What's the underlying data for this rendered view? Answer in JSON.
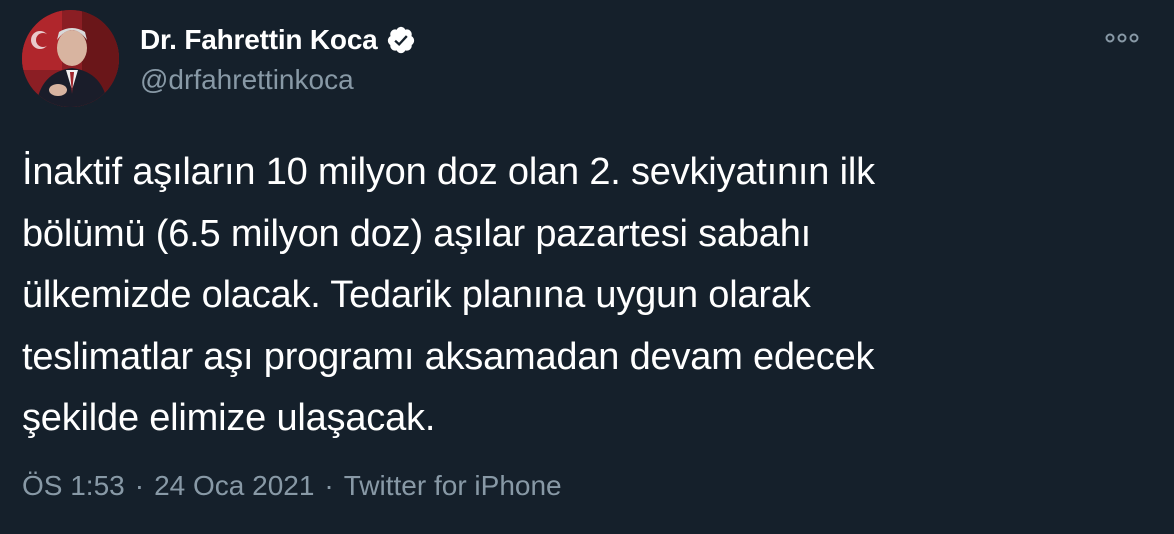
{
  "author": {
    "display_name": "Dr. Fahrettin Koca",
    "handle": "@drfahrettinkoca",
    "verified": true,
    "avatar_icon": "profile-photo-icon"
  },
  "tweet": {
    "lines": [
      "İnaktif aşıların 10 milyon doz olan 2. sevkiyatının ilk",
      "bölümü (6.5 milyon doz) aşılar pazartesi sabahı",
      "ülkemizde olacak. Tedarik planına uygun olarak",
      "teslimatlar aşı programı aksamadan devam edecek",
      "şekilde elimize ulaşacak."
    ],
    "time": "ÖS 1:53",
    "separator": "·",
    "date": "24 Oca 2021",
    "source": "Twitter for iPhone"
  },
  "colors": {
    "background": "#15202b",
    "text": "#ffffff",
    "secondary": "#8899a6",
    "verified_badge": "#ffffff"
  },
  "icons": {
    "more": "more-options-icon",
    "verified": "verified-badge-icon"
  }
}
